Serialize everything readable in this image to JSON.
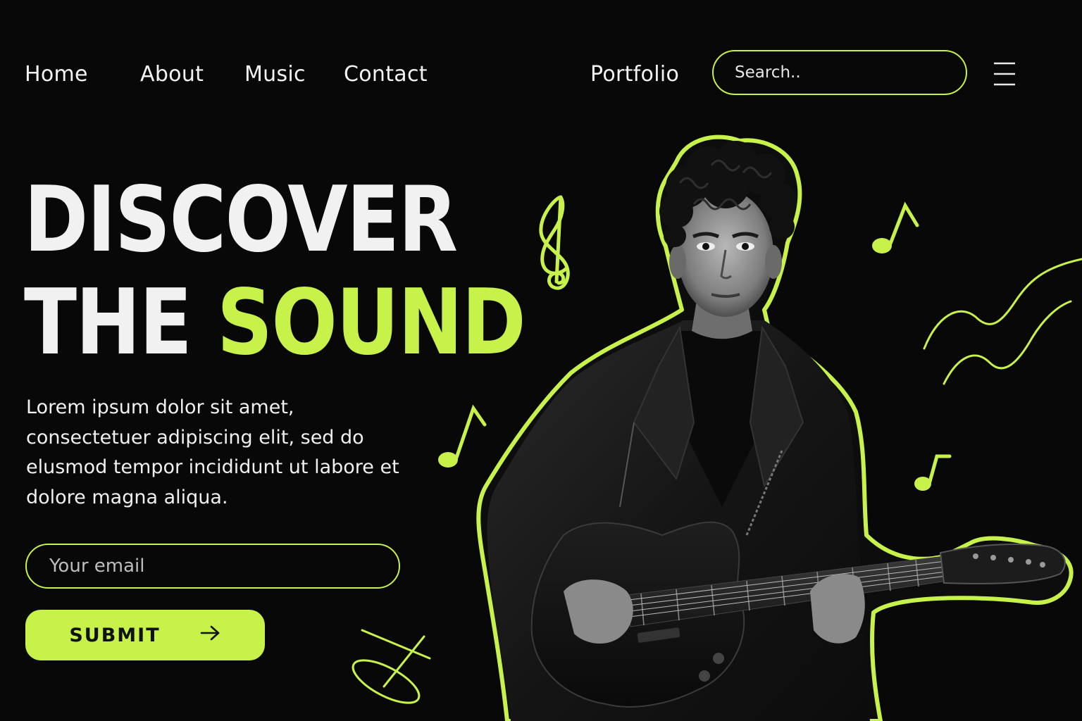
{
  "nav": {
    "links": [
      "Home",
      "About",
      "Music",
      "Contact",
      "Portfolio"
    ],
    "search_placeholder": "Search.."
  },
  "hero": {
    "title_line1": "DISCOVER",
    "title_line2_white": "THE",
    "title_line2_accent": "SOUND",
    "description": "Lorem ipsum dolor sit amet, consectetuer adipiscing elit, sed do elusmod tempor incididunt ut labore et dolore magna aliqua.",
    "email_placeholder": "Your email",
    "submit_label": "SUBMIT"
  },
  "icons": {
    "menu": "hamburger-menu-icon",
    "submit": "arrow-right-icon"
  },
  "colors": {
    "background": "#080808",
    "accent": "#c6f24a",
    "text": "#f1f1f1"
  }
}
